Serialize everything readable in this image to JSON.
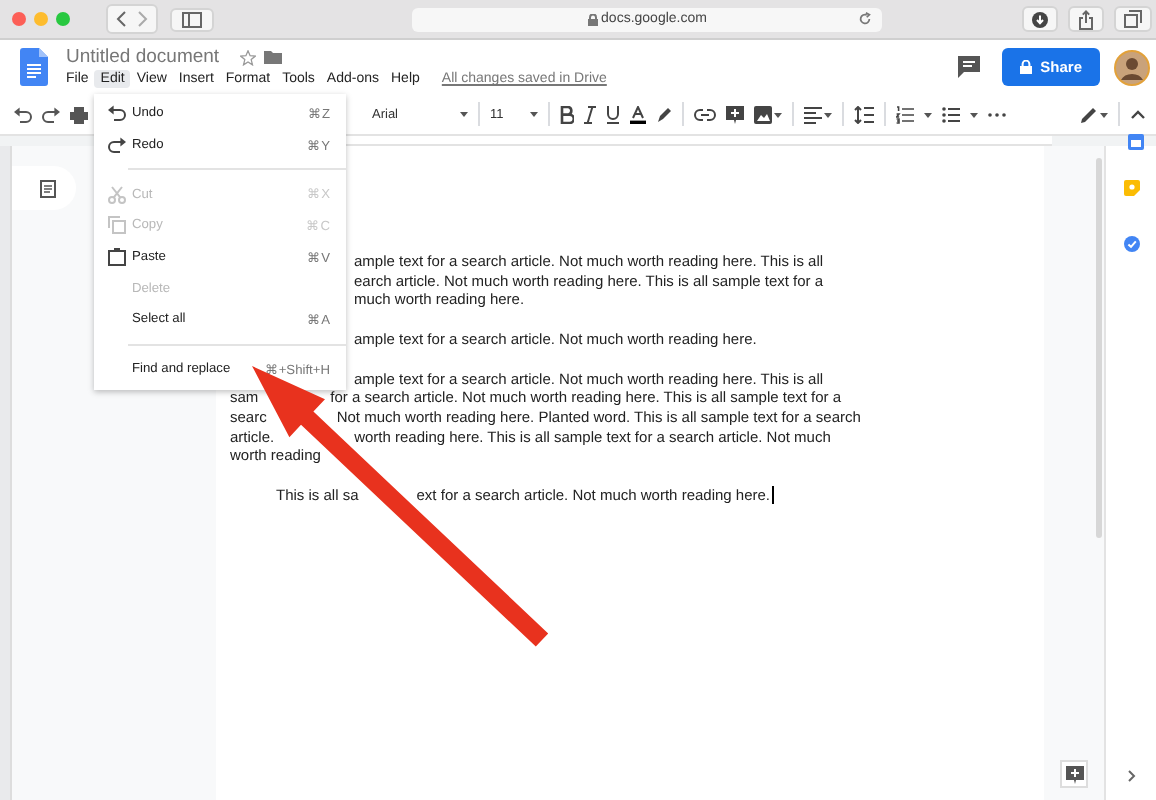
{
  "browser": {
    "url": "docs.google.com"
  },
  "header": {
    "title": "Untitled document",
    "save_status": "All changes saved in Drive",
    "share_label": "Share"
  },
  "menus": [
    {
      "label": "File",
      "selected": false
    },
    {
      "label": "Edit",
      "selected": true
    },
    {
      "label": "View",
      "selected": false
    },
    {
      "label": "Insert",
      "selected": false
    },
    {
      "label": "Format",
      "selected": false
    },
    {
      "label": "Tools",
      "selected": false
    },
    {
      "label": "Add-ons",
      "selected": false
    },
    {
      "label": "Help",
      "selected": false
    }
  ],
  "toolbar": {
    "font": "Arial",
    "font_size": "11"
  },
  "edit_menu": {
    "items": [
      {
        "kind": "icon-item",
        "label": "Undo",
        "shortcut": "⌘Z",
        "disabled": false
      },
      {
        "kind": "icon-item",
        "label": "Redo",
        "shortcut": "⌘Y",
        "disabled": false
      },
      {
        "kind": "divider"
      },
      {
        "kind": "icon-item",
        "label": "Cut",
        "shortcut": "⌘X",
        "disabled": true
      },
      {
        "kind": "icon-item",
        "label": "Copy",
        "shortcut": "⌘C",
        "disabled": true
      },
      {
        "kind": "icon-item",
        "label": "Paste",
        "shortcut": "⌘V",
        "disabled": false
      },
      {
        "kind": "item",
        "label": "Delete",
        "disabled": true
      },
      {
        "kind": "item",
        "label": "Select all",
        "shortcut": "⌘A",
        "disabled": false
      },
      {
        "kind": "divider"
      },
      {
        "kind": "item",
        "label": "Find and replace",
        "shortcut": "⌘+Shift+H",
        "disabled": false
      }
    ]
  },
  "page": {
    "paragraphs": [
      {
        "lines": [
          {
            "kind": "partial",
            "parts": [
              "ample text for a search article. Not much worth reading here. This is all"
            ]
          },
          {
            "kind": "partial",
            "parts": [
              "earch article. Not much worth reading here. This is all sample text for a"
            ]
          },
          {
            "kind": "partial",
            "parts": [
              "much worth reading here."
            ]
          }
        ]
      },
      {
        "lines": [
          {
            "kind": "partial",
            "parts": [
              "ample text for a search article. Not much worth reading here."
            ]
          }
        ]
      },
      {
        "lines": [
          {
            "kind": "partial",
            "parts": [
              "ample text for a search article. Not much worth reading here. This is all"
            ]
          },
          {
            "kind": "full",
            "parts": [
              "sam",
              "for a search article. Not much worth reading here. This is all sample text for a"
            ]
          },
          {
            "kind": "full",
            "parts": [
              "searc",
              "Not much worth reading here. Planted word. This is all sample text for a search"
            ]
          },
          {
            "kind": "full",
            "parts": [
              "article.",
              "worth reading here. This is all sample text for a search article. Not much"
            ]
          },
          {
            "kind": "full",
            "parts": [
              "worth reading"
            ]
          }
        ]
      },
      {
        "lines": [
          {
            "kind": "indented",
            "parts": [
              "This is all sa",
              "ext for a search article. Not much worth reading here."
            ]
          }
        ]
      }
    ]
  }
}
